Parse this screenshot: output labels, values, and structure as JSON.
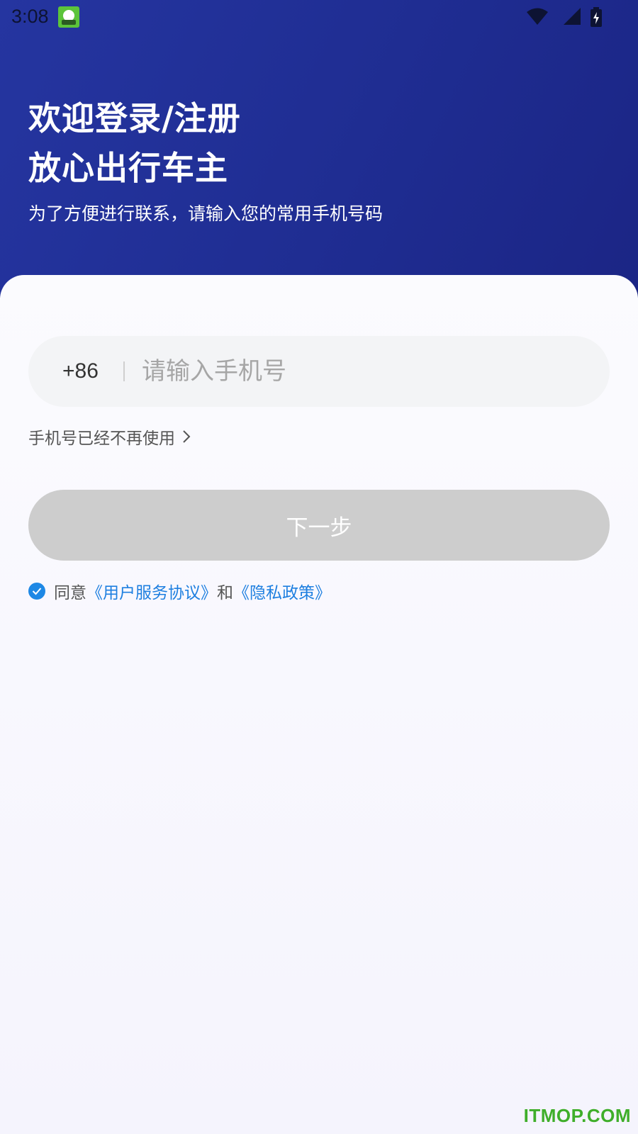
{
  "status_bar": {
    "time": "3:08",
    "icons": [
      "app-notification-icon",
      "wifi-icon",
      "signal-icon",
      "battery-charging-icon"
    ]
  },
  "header": {
    "title_line1": "欢迎登录/注册",
    "title_line2": "放心出行车主",
    "subtitle": "为了方便进行联系，请输入您的常用手机号码"
  },
  "form": {
    "country_code": "+86",
    "phone_value": "",
    "phone_placeholder": "请输入手机号",
    "phone_unused_label": "手机号已经不再使用",
    "next_label": "下一步"
  },
  "agreement": {
    "checked": true,
    "prefix": "同意",
    "user_agreement": "《用户服务协议》",
    "conjunction": "和",
    "privacy_policy": "《隐私政策》"
  },
  "watermark": "ITMOP.COM",
  "colors": {
    "header_bg": "#1f2d92",
    "button_disabled": "#cdcdcd",
    "link": "#1e7fe0",
    "checkbox": "#1e88e5",
    "watermark": "#3fae2a"
  }
}
